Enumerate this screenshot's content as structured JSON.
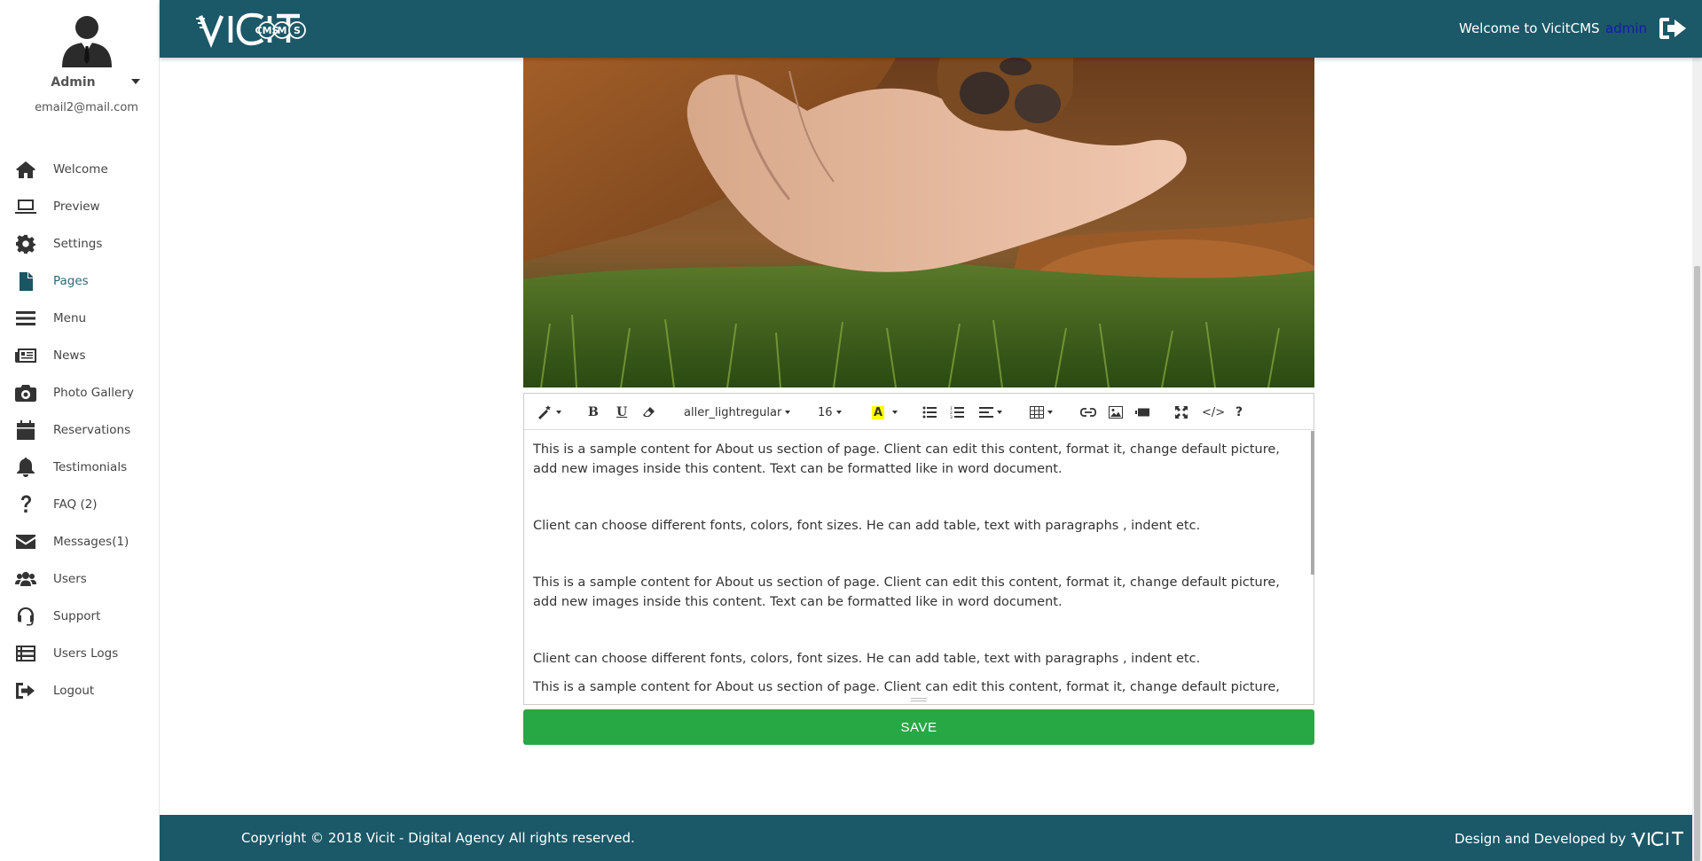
{
  "sidebar": {
    "user_name": "Admin",
    "user_email": "email2@mail.com",
    "items": [
      {
        "label": "Welcome",
        "icon": "home-icon"
      },
      {
        "label": "Preview",
        "icon": "laptop-icon"
      },
      {
        "label": "Settings",
        "icon": "gear-icon"
      },
      {
        "label": "Pages",
        "icon": "file-icon",
        "active": true
      },
      {
        "label": "Menu",
        "icon": "bars-icon"
      },
      {
        "label": "News",
        "icon": "newspaper-icon"
      },
      {
        "label": "Photo Gallery",
        "icon": "camera-icon"
      },
      {
        "label": "Reservations",
        "icon": "calendar-icon"
      },
      {
        "label": "Testimonials",
        "icon": "bell-icon"
      },
      {
        "label": "FAQ (2)",
        "icon": "question-icon"
      },
      {
        "label": "Messages(1)",
        "icon": "envelope-icon"
      },
      {
        "label": "Users",
        "icon": "users-icon"
      },
      {
        "label": "Support",
        "icon": "headset-icon"
      },
      {
        "label": "Users Logs",
        "icon": "list-icon"
      },
      {
        "label": "Logout",
        "icon": "sign-out-icon"
      }
    ]
  },
  "header": {
    "logo_text": "VICIT",
    "logo_sub": "CMS",
    "welcome": "Welcome to VicitCMS",
    "user_link": "admin"
  },
  "editor": {
    "toolbar": {
      "font_name": "aller_lightregular",
      "font_size": "16",
      "bold": "B",
      "underline": "U",
      "help": "?",
      "code": "</>"
    },
    "paragraphs": [
      "This is a sample content for About us section of page. Client can edit this content, format it, change default picture, add new images inside this content. Text can be formatted like in word document.",
      "Client can choose different fonts, colors, font sizes. He can add table, text with paragraphs , indent etc.",
      "This is a sample content for About us section of page. Client can edit this content, format it, change default picture, add new images inside this content. Text can be formatted like in word document.",
      "Client can choose different fonts, colors, font sizes. He can add table, text with paragraphs , indent etc.",
      "This is a sample content for About us section of page. Client can edit this content, format it, change default picture, add"
    ],
    "save_label": "SAVE"
  },
  "footer": {
    "copyright": "Copyright © 2018 Vicit - Digital Agency All rights reserved.",
    "credit": "Design and Developed by",
    "credit_logo": "VICIT"
  },
  "colors": {
    "header_bg": "#1b5868",
    "save_bg": "#28a745",
    "active_nav": "#2a6a7a",
    "admin_link": "#1a1aa8"
  }
}
